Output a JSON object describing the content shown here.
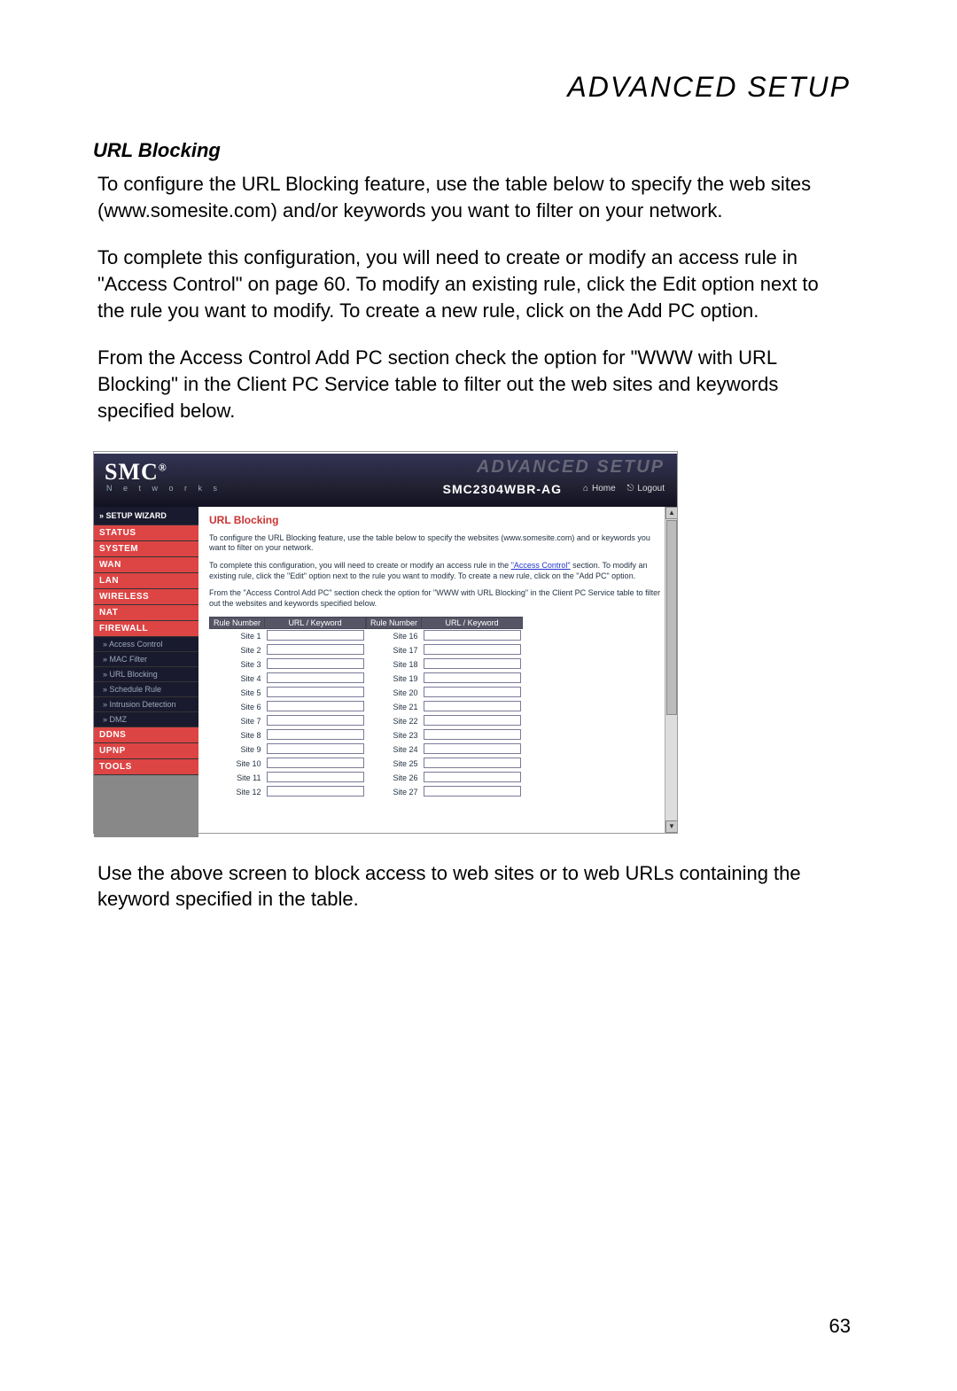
{
  "doc": {
    "page_title": "ADVANCED SETUP",
    "section_title": "URL Blocking",
    "p1": "To configure the URL Blocking feature, use the table below to specify the web sites (www.somesite.com) and/or keywords you want to filter on your network.",
    "p2": "To complete this configuration, you will need to create or modify an access rule in \"Access Control\" on page 60. To modify an existing rule, click the Edit option next to the rule you want to modify. To create a new rule, click on the Add PC option.",
    "p3": "From the Access Control Add PC section check the option for \"WWW with URL Blocking\" in the Client PC Service table to filter out the web sites and keywords specified below.",
    "p4": "Use the above screen to block access to web sites or to web URLs containing the keyword specified in the table.",
    "page_number": "63"
  },
  "ui": {
    "brand": "SMC",
    "brand_reg": "®",
    "brand_sub": "N e t w o r k s",
    "adv_label": "ADVANCED SETUP",
    "model": "SMC2304WBR-AG",
    "home_label": "Home",
    "logout_label": "Logout",
    "sidebar": {
      "setup_wizard": "» SETUP WIZARD",
      "status": "STATUS",
      "system": "SYSTEM",
      "wan": "WAN",
      "lan": "LAN",
      "wireless": "WIRELESS",
      "nat": "NAT",
      "firewall": "FIREWALL",
      "sub_access": "Access Control",
      "sub_mac": "MAC Filter",
      "sub_url": "URL Blocking",
      "sub_schedule": "Schedule Rule",
      "sub_intrusion": "Intrusion Detection",
      "sub_dmz": "DMZ",
      "ddns": "DDNS",
      "upnp": "UPnP",
      "tools": "TOOLS"
    },
    "main": {
      "heading": "URL Blocking",
      "p1a": "To configure the URL Blocking feature, use the table below to specify the websites (www.somesite.com) and or keywords you want to filter on your network.",
      "p2a_pre": "To complete this configuration, you will need to create or modify an access rule in the ",
      "p2a_link": "\"Access Control\"",
      "p2a_post": " section. To modify an existing rule, click the \"Edit\" option next to the rule you want to modify. To create a new rule, click on the \"Add PC\" option.",
      "p3a": "From the \"Access Control Add PC\" section check the option for \"WWW with URL Blocking\" in the Client PC Service table to filter out the websites and keywords specified below.",
      "th_rule": "Rule Number",
      "th_url": "URL / Keyword",
      "left_rows": [
        "Site  1",
        "Site  2",
        "Site  3",
        "Site  4",
        "Site  5",
        "Site  6",
        "Site  7",
        "Site  8",
        "Site  9",
        "Site  10",
        "Site  11",
        "Site  12"
      ],
      "right_rows": [
        "Site  16",
        "Site  17",
        "Site  18",
        "Site  19",
        "Site  20",
        "Site  21",
        "Site  22",
        "Site  23",
        "Site  24",
        "Site  25",
        "Site  26",
        "Site  27"
      ]
    }
  }
}
